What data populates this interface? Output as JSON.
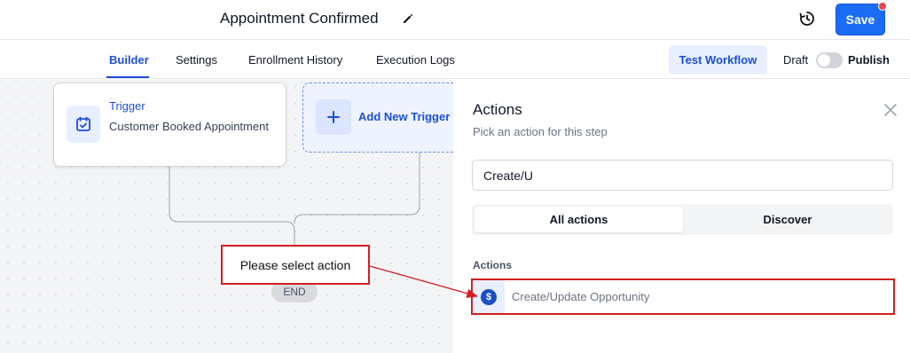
{
  "header": {
    "title": "Appointment Confirmed",
    "save_label": "Save"
  },
  "tabs": [
    {
      "label": "Builder",
      "active": true
    },
    {
      "label": "Settings"
    },
    {
      "label": "Enrollment History"
    },
    {
      "label": "Execution Logs"
    }
  ],
  "toolbar": {
    "test_workflow_label": "Test Workflow",
    "draft_label": "Draft",
    "publish_label": "Publish"
  },
  "canvas": {
    "trigger_title": "Trigger",
    "trigger_subtitle": "Customer Booked Appointment",
    "add_trigger_label": "Add New Trigger",
    "end_label": "END"
  },
  "annotation": {
    "text": "Please select action"
  },
  "panel": {
    "title": "Actions",
    "subtitle": "Pick an action for this step",
    "search_value": "Create/U",
    "segments": [
      "All actions",
      "Discover"
    ],
    "section_label": "Actions",
    "action_item": "Create/Update Opportunity",
    "action_icon_glyph": "$"
  },
  "colors": {
    "accent": "#1a6cf5",
    "accent_text": "#1d4ed8",
    "annotation_red": "#d11f1f"
  }
}
